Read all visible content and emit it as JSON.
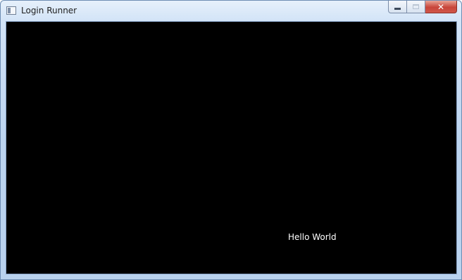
{
  "window": {
    "title": "Login Runner",
    "icon": "application-window-icon",
    "buttons": {
      "minimize": "minimize-icon",
      "maximize": "maximize-icon",
      "close": "close-icon",
      "close_glyph": "✕"
    }
  },
  "client": {
    "background": "#000000",
    "text": "Hello World",
    "text_color": "#ffffff"
  }
}
